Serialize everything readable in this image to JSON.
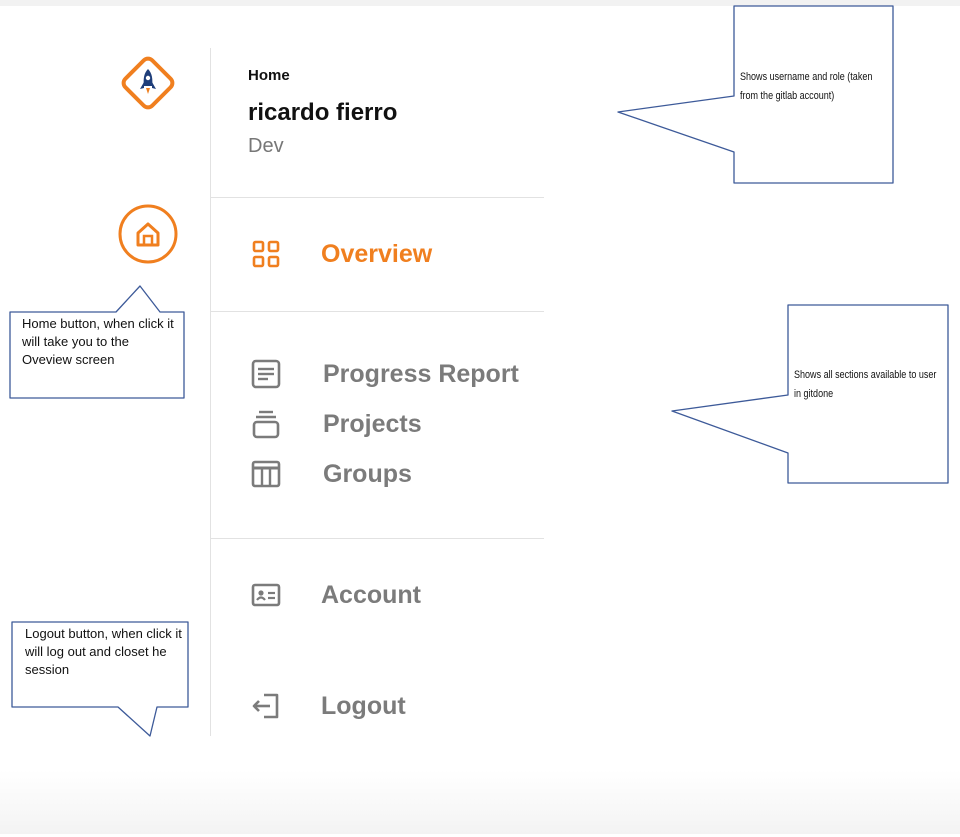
{
  "header": {
    "breadcrumb": "Home",
    "username": "ricardo fierro",
    "role": "Dev"
  },
  "nav": {
    "overview": "Overview",
    "progress_report": "Progress Report",
    "projects": "Projects",
    "groups": "Groups",
    "account": "Account",
    "logout": "Logout"
  },
  "annotations": {
    "user_info_note": "Shows username and role (taken from the gitlab account)",
    "sections_note": "Shows all sections available to user in gitdone",
    "home_note": "Home button, when click it will take you to the Oveview screen",
    "logout_note": "Logout button, when click it will log out and closet he session"
  },
  "colors": {
    "accent": "#f07f1f",
    "nav_inactive": "#7b7b7b",
    "callout_border": "#3d5a99",
    "logo_rocket": "#1f3e7a"
  },
  "icons": {
    "logo": "rocket-icon",
    "home": "home-icon",
    "overview": "grid-icon",
    "progress_report": "document-icon",
    "projects": "stack-icon",
    "groups": "columns-icon",
    "account": "id-card-icon",
    "logout": "logout-icon"
  }
}
